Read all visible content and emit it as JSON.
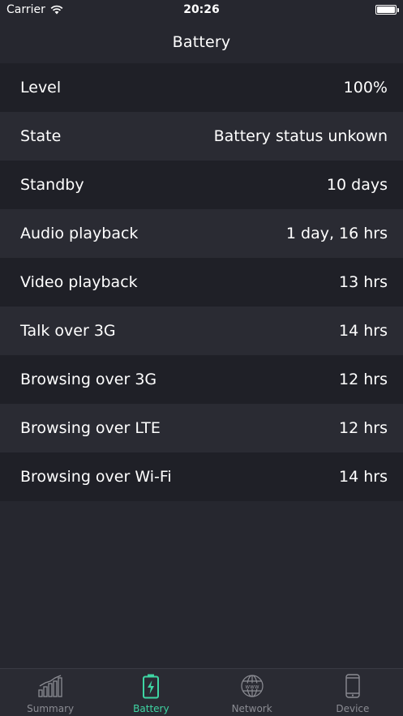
{
  "status_bar": {
    "carrier": "Carrier",
    "time": "20:26"
  },
  "nav": {
    "title": "Battery"
  },
  "rows": [
    {
      "label": "Level",
      "value": "100%"
    },
    {
      "label": "State",
      "value": "Battery status unkown"
    },
    {
      "label": "Standby",
      "value": "10 days"
    },
    {
      "label": "Audio playback",
      "value": "1 day, 16 hrs"
    },
    {
      "label": "Video playback",
      "value": "13 hrs"
    },
    {
      "label": "Talk over 3G",
      "value": "14 hrs"
    },
    {
      "label": "Browsing over 3G",
      "value": "12 hrs"
    },
    {
      "label": "Browsing over LTE",
      "value": "12 hrs"
    },
    {
      "label": "Browsing over Wi-Fi",
      "value": "14 hrs"
    }
  ],
  "tabs": [
    {
      "label": "Summary",
      "icon": "bar-chart-icon",
      "active": false
    },
    {
      "label": "Battery",
      "icon": "battery-icon",
      "active": true
    },
    {
      "label": "Network",
      "icon": "globe-www-icon",
      "active": false
    },
    {
      "label": "Device",
      "icon": "phone-icon",
      "active": false
    }
  ],
  "colors": {
    "background": "#26272f",
    "row_dark": "#1f2027",
    "row_light": "#2a2b33",
    "accent": "#3ed5a3",
    "tab_inactive": "#8b8c93"
  }
}
